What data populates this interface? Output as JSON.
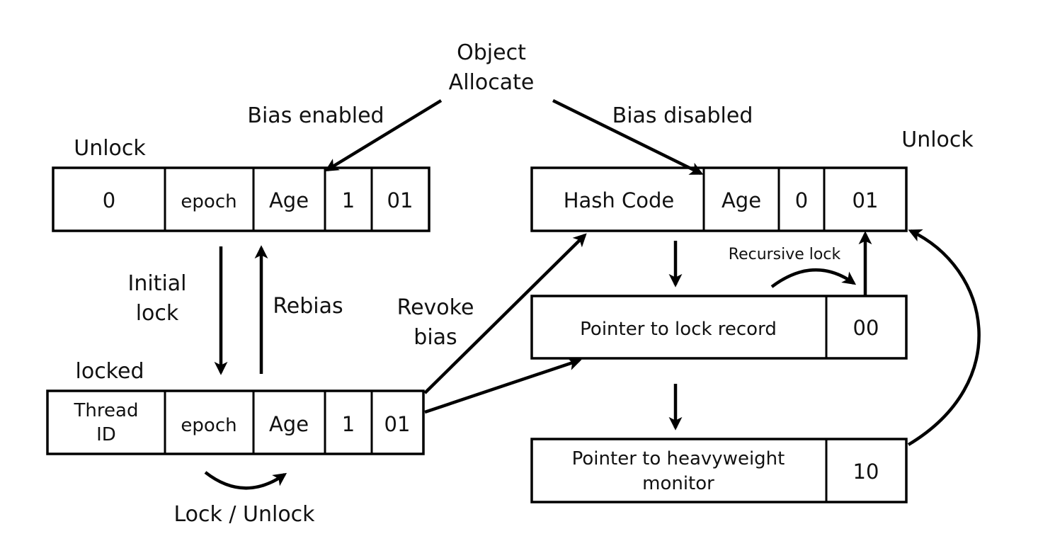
{
  "diagram": {
    "title_lines": [
      "Object",
      "Allocate"
    ],
    "labels": {
      "bias_enabled": "Bias enabled",
      "bias_disabled": "Bias disabled",
      "unlock_left": "Unlock",
      "unlock_right": "Unlock",
      "locked": "locked",
      "initial_lock": [
        "Initial",
        "lock"
      ],
      "rebias": "Rebias",
      "revoke_bias": [
        "Revoke",
        "bias"
      ],
      "recursive_lock": "Recursive lock",
      "lock_unlock": "Lock / Unlock"
    },
    "boxes": {
      "biased_unlocked": [
        "0",
        "epoch",
        "Age",
        "1",
        "01"
      ],
      "biased_locked": [
        [
          "Thread",
          "ID"
        ],
        "epoch",
        "Age",
        "1",
        "01"
      ],
      "normal_unlocked": [
        "Hash Code",
        "Age",
        "0",
        "01"
      ],
      "lightweight_locked": [
        "Pointer to lock record",
        "00"
      ],
      "heavyweight_locked": [
        [
          "Pointer to heavyweight",
          "monitor"
        ],
        "10"
      ]
    },
    "edges": [
      {
        "from": "object-allocate",
        "to": "biased_unlocked",
        "label": "Bias enabled"
      },
      {
        "from": "object-allocate",
        "to": "normal_unlocked",
        "label": "Bias disabled"
      },
      {
        "from": "biased_unlocked",
        "to": "biased_locked",
        "label": "Initial lock"
      },
      {
        "from": "biased_locked",
        "to": "biased_unlocked",
        "label": "Rebias"
      },
      {
        "from": "biased_locked",
        "to": "normal_unlocked",
        "label": "Revoke bias"
      },
      {
        "from": "biased_locked",
        "to": "lightweight_locked",
        "label": ""
      },
      {
        "from": "biased_locked",
        "to": "biased_locked",
        "label": "Lock / Unlock"
      },
      {
        "from": "normal_unlocked",
        "to": "lightweight_locked",
        "label": ""
      },
      {
        "from": "lightweight_locked",
        "to": "lightweight_locked",
        "label": "Recursive lock"
      },
      {
        "from": "lightweight_locked",
        "to": "normal_unlocked",
        "label": ""
      },
      {
        "from": "lightweight_locked",
        "to": "heavyweight_locked",
        "label": ""
      },
      {
        "from": "heavyweight_locked",
        "to": "normal_unlocked",
        "label": ""
      }
    ]
  }
}
